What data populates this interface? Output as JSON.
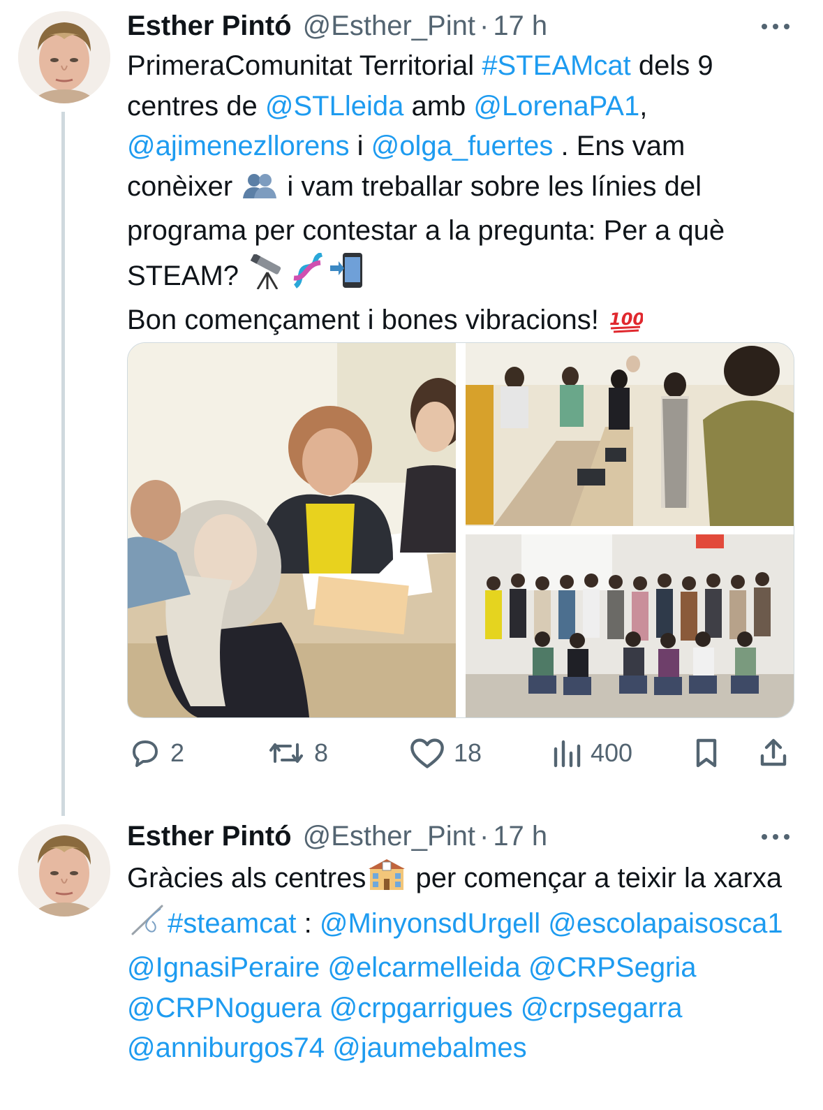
{
  "tweets": [
    {
      "author": {
        "name": "Esther Pintó",
        "handle": "@Esther_Pint",
        "time": "17 h"
      },
      "body": {
        "t1": "PrimeraComunitat Territorial ",
        "m1": "#STEAMcat",
        "t2": " dels 9 centres de ",
        "m2": "@STLleida",
        "t3": " amb ",
        "m3": "@LorenaPA1",
        "t4": ", ",
        "m4": "@ajimenezllorens",
        "t5": " i ",
        "m5": "@olga_fuertes",
        "t6": " . Ens vam conèixer ",
        "t7": " i vam treballar sobre les línies del programa per contestar a la pregunta: Per a què STEAM? ",
        "t8": "Bon començament i bones vibracions! "
      },
      "emoji": [
        "busts-in-silhouette-icon",
        "telescope-icon",
        "dna-icon",
        "mobile-arrow-icon",
        "hundred-points-icon"
      ],
      "media": [
        "photo-group-at-table",
        "photo-classroom-laptops",
        "photo-group-portrait"
      ],
      "stats": {
        "replies": "2",
        "retweets": "8",
        "likes": "18",
        "views": "400"
      }
    },
    {
      "author": {
        "name": "Esther Pintó",
        "handle": "@Esther_Pint",
        "time": "17 h"
      },
      "body": {
        "t1": "Gràcies als centres",
        "t2": " per començar a teixir la xarxa ",
        "m1": "#steamcat",
        "t3": " : ",
        "m2": "@MinyonsdUrgell",
        "m3": "@escolapaisosca1",
        "m4": "@IgnasiPeraire",
        "m5": "@elcarmelleida",
        "m6": "@CRPSegria",
        "m7": "@CRPNoguera",
        "m8": "@crpgarrigues",
        "m9": "@crpsegarra",
        "m10": "@anniburgos74",
        "m11": "@jaumebalmes"
      },
      "emoji": [
        "school-icon",
        "sewing-needle-icon"
      ]
    }
  ],
  "colors": {
    "link": "#1d9bf0",
    "muted": "#536471",
    "text": "#0f1419",
    "thread_line": "#cfd9de"
  }
}
